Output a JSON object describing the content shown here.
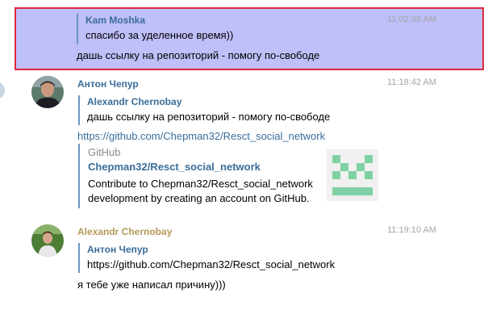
{
  "messages": [
    {
      "quote": {
        "author": "Kam Moshka",
        "text": "спасибо за уделенное время))"
      },
      "text": "дашь ссылку на репозиторий - помогу по-свободе",
      "time": "11:02:38 AM"
    },
    {
      "author": "Антон Чепур",
      "author_color": "#3a6d99",
      "time": "11:18:42 AM",
      "quote": {
        "author": "Alexandr Chernobay",
        "text": "дашь ссылку на репозиторий - помогу по-свободе"
      },
      "link": "https://github.com/Chepman32/Resct_social_network",
      "preview": {
        "site": "GitHub",
        "title": "Chepman32/Resct_social_network",
        "description_line1": "Contribute to Chepman32/Resct_social_network",
        "description_line2": "development by creating an account on GitHub."
      }
    },
    {
      "author": "Alexandr Chernobay",
      "author_color": "#b59a58",
      "time": "11:19:10 AM",
      "quote": {
        "author": "Антон Чепур",
        "text": "https://github.com/Chepman32/Resct_social_network"
      },
      "text": "я тебе уже написал причину)))"
    }
  ],
  "colors": {
    "selection_bg": "#bfbff9",
    "selection_border": "#e0283a",
    "quote_bar": "#6c96c3",
    "link": "#3a6d99",
    "identicon": "#7fd0a4"
  }
}
